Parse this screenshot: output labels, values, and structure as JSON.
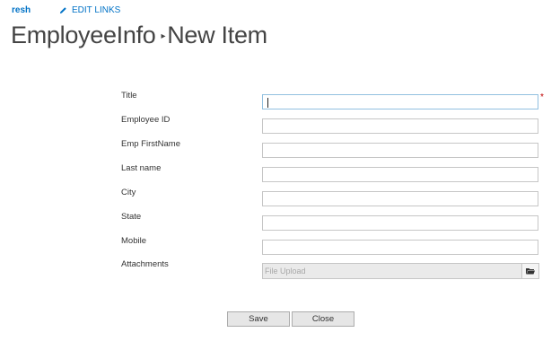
{
  "nav": {
    "site_link": "resh",
    "edit_links": "EDIT LINKS"
  },
  "page": {
    "list_name": "EmployeeInfo",
    "separator_icon": "triangle-right",
    "sub_title": "New Item"
  },
  "form": {
    "fields": [
      {
        "label": "Title",
        "value": "",
        "required": true,
        "focused": true
      },
      {
        "label": "Employee ID",
        "value": ""
      },
      {
        "label": "Emp FirstName",
        "value": ""
      },
      {
        "label": "Last name",
        "value": ""
      },
      {
        "label": "City",
        "value": ""
      },
      {
        "label": "State",
        "value": ""
      },
      {
        "label": "Mobile",
        "value": ""
      }
    ],
    "required_marker": "*",
    "attachments": {
      "label": "Attachments",
      "placeholder": "File Upload",
      "browse_icon": "folder-icon"
    }
  },
  "buttons": {
    "save": "Save",
    "close": "Close"
  }
}
